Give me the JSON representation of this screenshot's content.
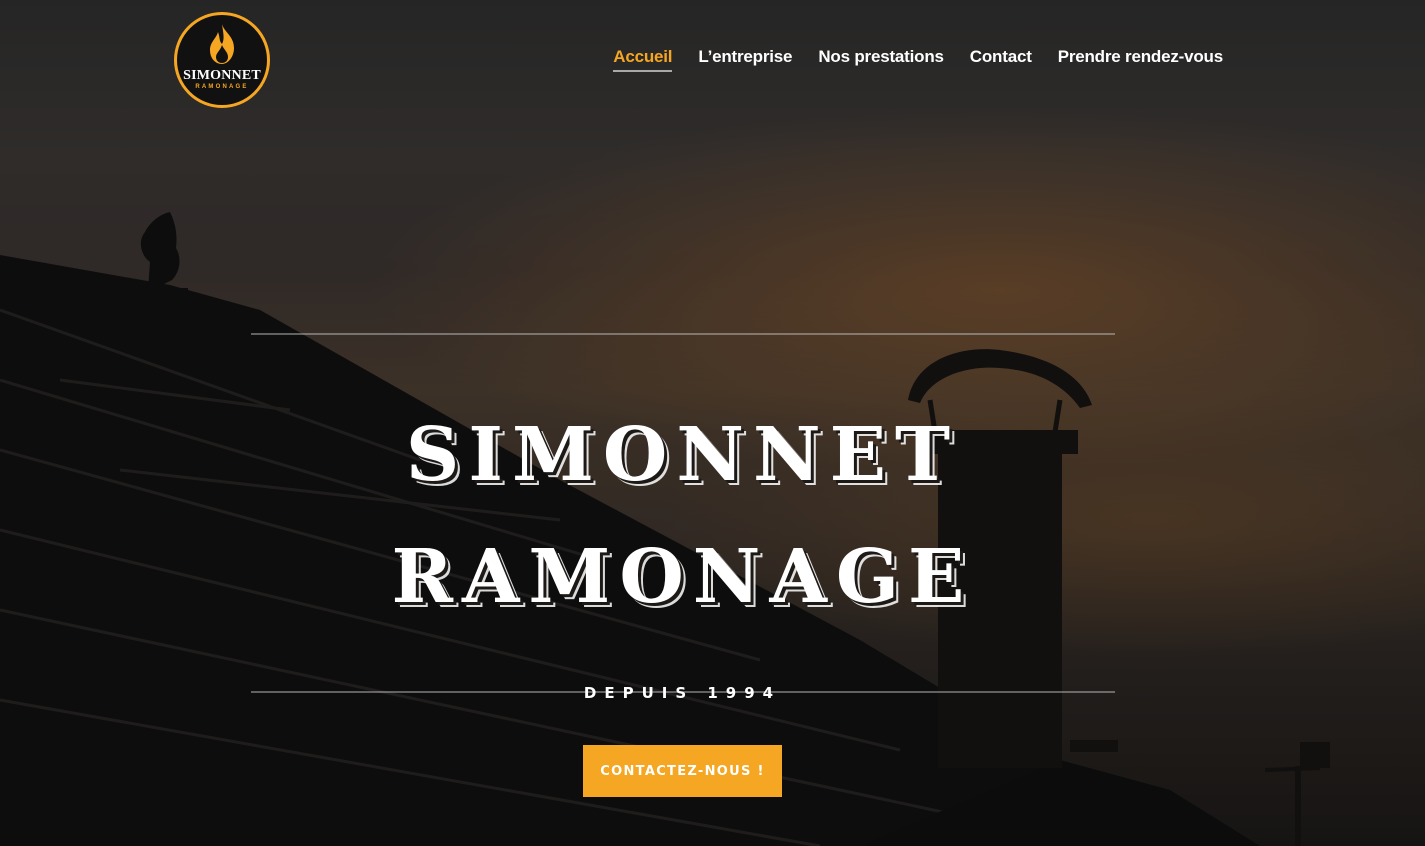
{
  "brand": {
    "logo_name": "SIMONNET",
    "logo_sub": "RAMONAGE",
    "logo_icon": "flame-icon",
    "accent": "#f5a623"
  },
  "nav": {
    "items": [
      {
        "label": "Accueil",
        "active": true
      },
      {
        "label": "L’entreprise",
        "active": false
      },
      {
        "label": "Nos prestations",
        "active": false
      },
      {
        "label": "Contact",
        "active": false
      },
      {
        "label": "Prendre rendez-vous",
        "active": false
      }
    ]
  },
  "hero": {
    "title_line1": "SIMONNET",
    "title_line2": "RAMONAGE",
    "since": "DEPUIS 1994",
    "cta_label": "CONTACTEZ-NOUS !"
  }
}
